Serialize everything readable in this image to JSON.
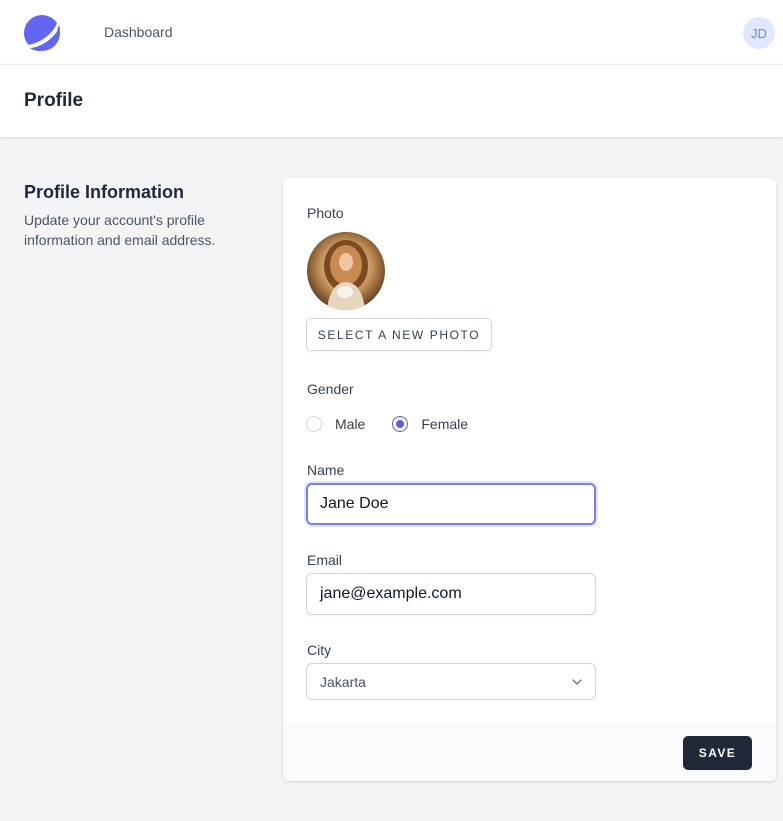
{
  "nav": {
    "logo_icon": "planet-logo-icon",
    "dashboard_link": "Dashboard",
    "user_initials": "JD",
    "accent_color": "#6366f1"
  },
  "header": {
    "title": "Profile"
  },
  "section": {
    "title": "Profile Information",
    "description": "Update your account's profile information and email address."
  },
  "form": {
    "photo_label": "Photo",
    "photo_icon": "user-photo",
    "select_photo_button": "SELECT A NEW PHOTO",
    "gender_label": "Gender",
    "gender_options": [
      {
        "label": "Male",
        "checked": false
      },
      {
        "label": "Female",
        "checked": true
      }
    ],
    "name_label": "Name",
    "name_value": "Jane Doe",
    "email_label": "Email",
    "email_value": "jane@example.com",
    "city_label": "City",
    "city_value": "Jakarta",
    "save_button": "SAVE"
  }
}
